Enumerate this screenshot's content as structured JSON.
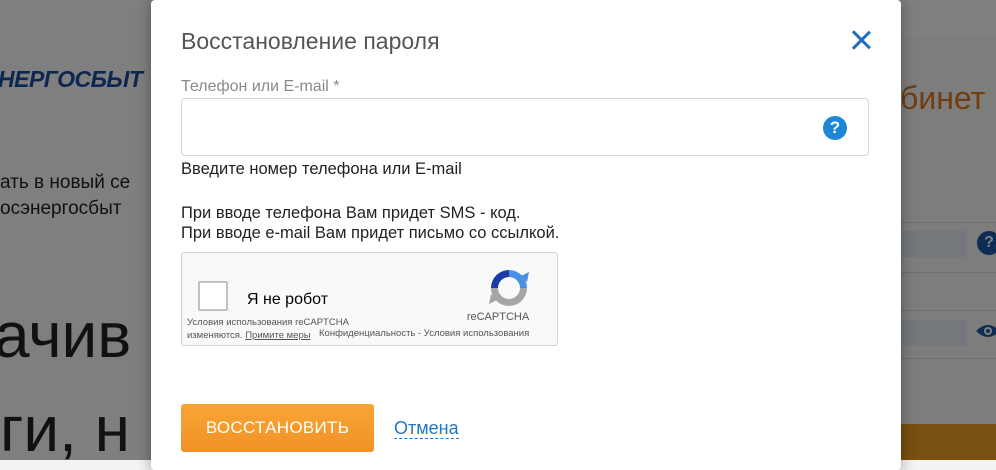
{
  "background": {
    "logo": "НЕРГОСБЫТ",
    "promo_line1": "ать в новый се",
    "promo_line2": "осэнергосбыт",
    "promo_big1": "ачив",
    "promo_big2": "ги, н",
    "cabinet": "бинет",
    "help_mark": "?"
  },
  "modal": {
    "title": "Восстановление пароля",
    "field_label": "Телефон или E-mail *",
    "field_value": "",
    "help_mark": "?",
    "hint": "Введите номер телефона или E-mail",
    "info_line1": "При вводе телефона Вам придет SMS - код.",
    "info_line2": "При вводе e-mail Вам придет письмо со ссылкой.",
    "recaptcha": {
      "label": "Я не робот",
      "brand": "reCAPTCHA",
      "terms_line1": "Условия использования reCAPTCHA",
      "terms_line2_prefix": "изменяются.",
      "terms_link": "Примите меры",
      "privacy": "Конфиденциальность - Условия использования"
    },
    "restore_button": "ВОССТАНОВИТЬ",
    "cancel_link": "Отмена"
  },
  "colors": {
    "accent_orange": "#f29227",
    "link_blue": "#1f78c3",
    "overlay": "rgba(0,0,0,0.5)"
  },
  "icons": [
    "close-icon",
    "help-icon",
    "recaptcha-logo-icon",
    "eye-icon"
  ]
}
